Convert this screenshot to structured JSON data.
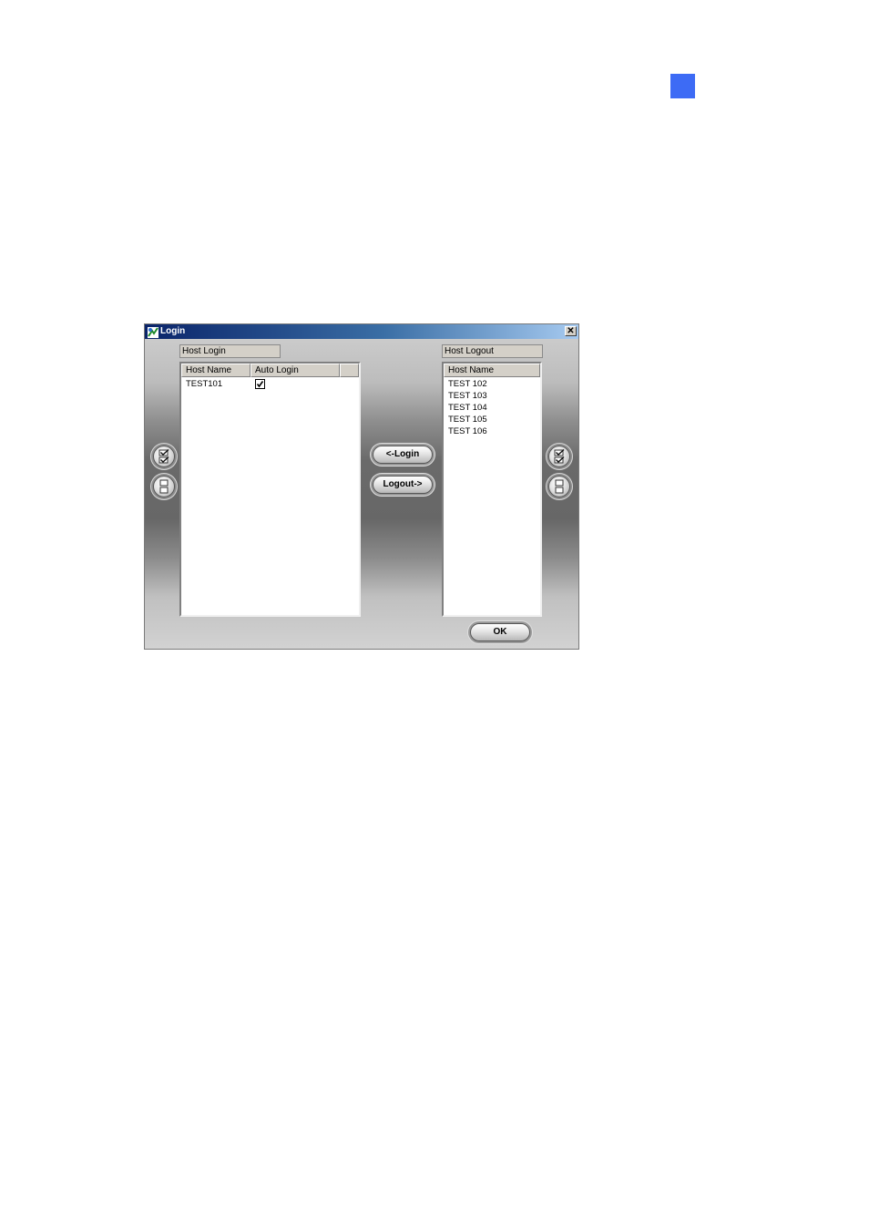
{
  "dialog": {
    "title": "Login",
    "close_glyph": "✕",
    "host_login": {
      "label": "Host Login",
      "columns": [
        "Host Name",
        "Auto Login"
      ],
      "rows": [
        {
          "host": "TEST101",
          "auto_login": true
        }
      ]
    },
    "host_logout": {
      "label": "Host Logout",
      "columns": [
        "Host Name"
      ],
      "rows": [
        "TEST 102",
        "TEST 103",
        "TEST 104",
        "TEST 105",
        "TEST 106"
      ]
    },
    "buttons": {
      "login": "<-Login",
      "logout": "Logout->",
      "ok": "OK"
    },
    "side_icons": {
      "select_all": "check-all-icon",
      "clear_all": "uncheck-all-icon"
    }
  },
  "colors": {
    "page_marker": "#3d6bf5",
    "title_bar_start": "#0a246a",
    "title_bar_end": "#a6caf0"
  }
}
